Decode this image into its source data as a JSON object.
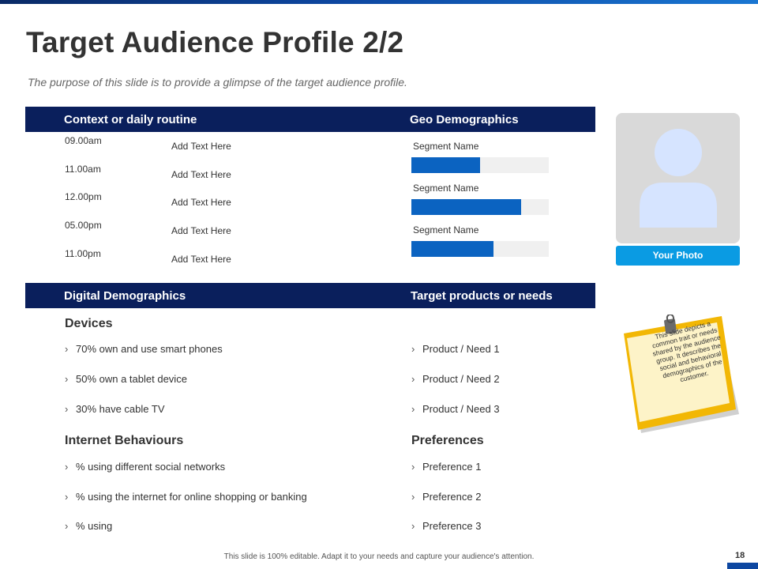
{
  "title": "Target Audience Profile 2/2",
  "subtitle": "The purpose of this slide is to provide a glimpse of the target audience profile.",
  "bands": {
    "context": "Context or daily routine",
    "geo": "Geo Demographics",
    "digital": "Digital Demographics",
    "target": "Target products or needs"
  },
  "routine": [
    {
      "time": "09.00am",
      "text": "Add Text Here"
    },
    {
      "time": "11.00am",
      "text": "Add Text Here"
    },
    {
      "time": "12.00pm",
      "text": "Add Text Here"
    },
    {
      "time": "05.00pm",
      "text": "Add Text Here"
    },
    {
      "time": "11.00pm",
      "text": "Add Text Here"
    }
  ],
  "segments": [
    {
      "label": "Segment Name",
      "value": 0.5
    },
    {
      "label": "Segment Name",
      "value": 0.8
    },
    {
      "label": "Segment Name",
      "value": 0.6
    }
  ],
  "devices": {
    "heading": "Devices",
    "items": [
      "70% own and use smart phones",
      "50% own a tablet device",
      "30% have cable TV"
    ]
  },
  "products": {
    "items": [
      "Product / Need 1",
      "Product / Need 2",
      "Product / Need 3"
    ]
  },
  "internet": {
    "heading": "Internet Behaviours",
    "items": [
      "% using different  social networks",
      "% using the internet for online shopping or banking",
      "% using"
    ]
  },
  "preferences": {
    "heading": "Preferences",
    "items": [
      "Preference  1",
      "Preference  2",
      "Preference  3"
    ]
  },
  "photo": {
    "label": "Your Photo"
  },
  "note": {
    "text": "This slide depicts a common trait or needs shared by the audience group. It describes the social and behavioral demographics of the customer."
  },
  "footer": "This slide is 100% editable.  Adapt it to your needs and capture your audience's attention.",
  "page_number": "18",
  "colors": {
    "band": "#0a1f5c",
    "bar_fill": "#0b63c1",
    "photo_button": "#0a9be3",
    "sticky_note": "#f5c518"
  }
}
